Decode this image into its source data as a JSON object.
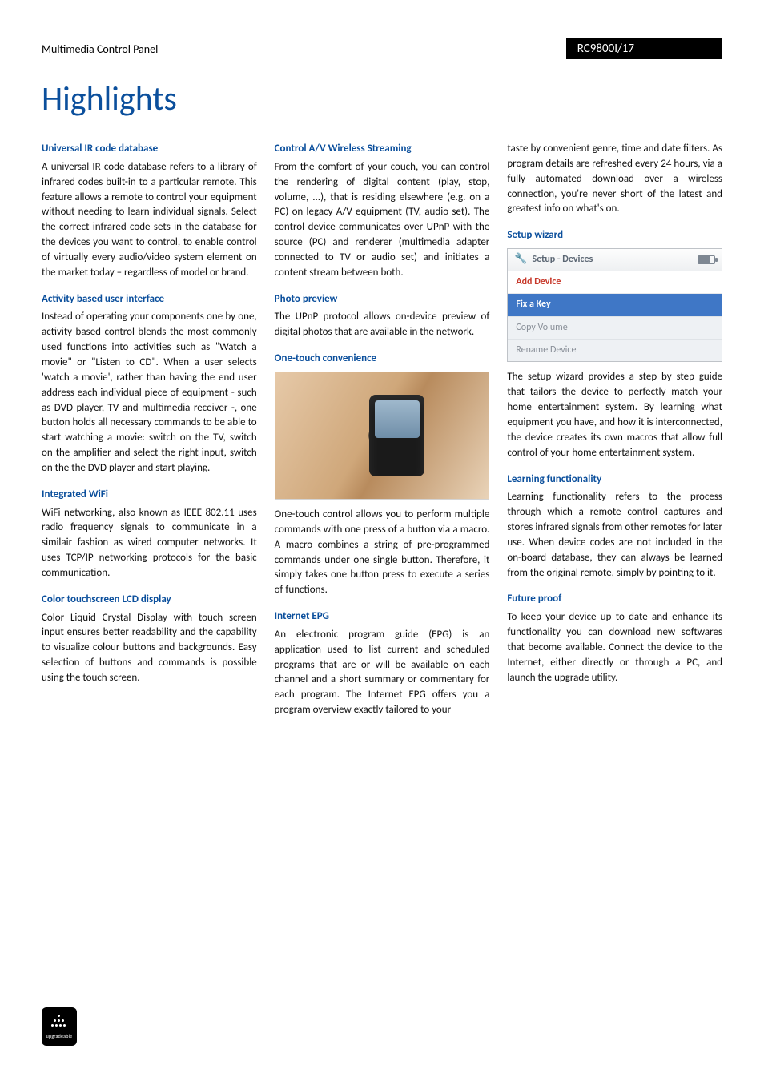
{
  "header": {
    "product_name": "Multimedia Control Panel",
    "model": "RC9800I/17"
  },
  "page_title": "Highlights",
  "columns": [
    {
      "sections": [
        {
          "title": "Universal IR code database",
          "body": "A universal IR code database refers to a library of infrared codes built-in to a particular remote. This feature allows a remote to control your equipment without needing to learn individual signals. Select the correct infrared code sets in the database for the devices you want to control, to enable control of virtually every audio/video system element on the market today – regardless of model or brand."
        },
        {
          "title": "Activity based user interface",
          "body": "Instead of operating your components one by one, activity based control blends the most commonly used functions into activities such as \"Watch a movie\" or \"Listen to CD\". When a user selects 'watch a movie', rather than having the end user address each individual piece of equipment - such as DVD player, TV and multimedia receiver -, one button holds all necessary commands to be able to start watching a movie: switch on the TV, switch on the amplifier and select the right input, switch on the the DVD player and start playing."
        },
        {
          "title": "Integrated WiFi",
          "body": "WiFi networking, also known as IEEE 802.11 uses radio frequency signals to communicate in a similair fashion as wired computer networks. It uses TCP/IP networking protocols for the basic communication."
        },
        {
          "title": "Color touchscreen LCD display",
          "body": "Color Liquid Crystal Display with touch screen input ensures better readability and the capability to visualize colour buttons and backgrounds. Easy selection of buttons and commands is possible using the touch screen."
        }
      ]
    },
    {
      "sections": [
        {
          "title": "Control A/V Wireless Streaming",
          "body": "From the comfort of your couch, you can control the rendering of digital content (play, stop, volume, ...), that is residing elsewhere (e.g. on a PC) on legacy A/V equipment (TV, audio set). The control device communicates over UPnP with the source (PC) and renderer (multimedia adapter connected to TV or audio set) and initiates a content stream between both."
        },
        {
          "title": "Photo preview",
          "body": "The UPnP protocol allows on-device preview of digital photos that are available in the network."
        },
        {
          "title": "One-touch convenience",
          "image": "onetouch",
          "body": "One-touch control allows you to perform multiple commands with one press of a button via a macro. A macro combines a string of pre-programmed commands under one single button. Therefore, it simply takes one button press to execute a series of functions."
        },
        {
          "title": "Internet EPG",
          "body": "An electronic program guide (EPG) is an application used to list current and scheduled programs that are or will be available on each channel and a short summary or commentary for each program. The Internet EPG offers you a program overview exactly tailored to your"
        }
      ]
    },
    {
      "sections": [
        {
          "body": "taste by convenient genre, time and date filters. As program details are refreshed every 24 hours, via a fully automated download over a wireless connection, you're never short of the latest and greatest info on what's on."
        },
        {
          "title": "Setup wizard",
          "image": "setup",
          "body": "The setup wizard provides a step by step guide that tailors the device to perfectly match your home entertainment system. By learning what equipment you have, and how it is interconnected, the device creates its own macros that allow full control of your home entertainment system."
        },
        {
          "title": "Learning functionality",
          "body": "Learning functionality refers to the process through which a remote control captures and stores infrared signals from other remotes for later use. When device codes are not included in the on-board database, they can always be learned from the original remote, simply by pointing to it."
        },
        {
          "title": "Future proof",
          "body": "To keep your device up to date and enhance its functionality you can download new softwares that become available. Connect the device to the Internet, either directly or through a PC, and launch the upgrade utility."
        }
      ]
    }
  ],
  "setup_screenshot": {
    "header_label": "Setup - Devices",
    "rows": [
      "Add Device",
      "Fix a Key",
      "Copy Volume",
      "Rename Device"
    ]
  },
  "footer_badge_label": "upgradeable"
}
